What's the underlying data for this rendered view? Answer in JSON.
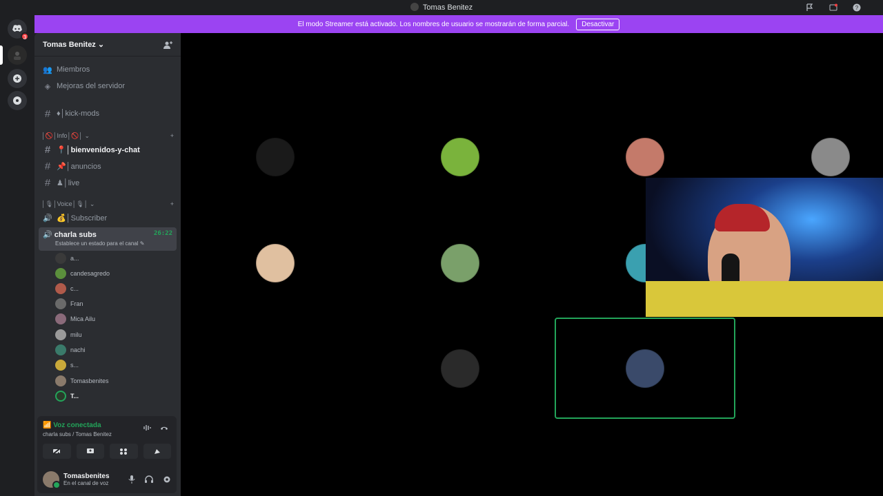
{
  "window": {
    "title": "Tomas Benitez"
  },
  "streamer_banner": {
    "text": "El modo Streamer está activado. Los nombres de usuario se mostrarán de forma parcial.",
    "button": "Desactivar",
    "color": "#9b44f2"
  },
  "guilds": {
    "badge_count": "3"
  },
  "server": {
    "name": "Tomas Benitez"
  },
  "sidebar": {
    "top_items": [
      {
        "label": "Miembros"
      },
      {
        "label": "Mejoras del servidor"
      }
    ],
    "kick_mods": "♦│kick-mods",
    "cat_info": "│🚫│Info│🚫│",
    "text_channels": [
      {
        "label": "📍│bienvenidos-y-chat"
      },
      {
        "label": "📌│anuncios"
      },
      {
        "label": "♟│live"
      }
    ],
    "cat_voice": "│🎙│Voice│🎙│",
    "subscriber": "💰│Subscriber",
    "voice_channel": {
      "name": "charla subs",
      "timer": "26:22",
      "status": "Establece un estado para el canal"
    },
    "voice_users": [
      {
        "name": "a...",
        "color": "#3a3a3a"
      },
      {
        "name": "candesagredo",
        "color": "#5b8f3c"
      },
      {
        "name": "c...",
        "color": "#b05a4a"
      },
      {
        "name": "Fran",
        "color": "#6a6a6a"
      },
      {
        "name": "Mica Ailu",
        "color": "#8a6a7a"
      },
      {
        "name": "milu",
        "color": "#9a9a9a"
      },
      {
        "name": "nachi",
        "color": "#3a7a6a"
      },
      {
        "name": "s...",
        "color": "#c9a93a"
      },
      {
        "name": "Tomasbenites",
        "color": "#8a7a6b"
      },
      {
        "name": "T...",
        "color": "#2a3a2a"
      }
    ]
  },
  "connection": {
    "status": "Voz conectada",
    "path": "charla subs / Tomas Benitez"
  },
  "user": {
    "name": "Tomasbenites",
    "status": "En el canal de voz"
  },
  "tiles": [
    {
      "bg": "#d49a6e",
      "av": "#1a1a1a"
    },
    {
      "bg": "#6e5439",
      "av": "#7ab33c"
    },
    {
      "bg": "#c98b72",
      "av": "#c47a6a"
    },
    {
      "bg": "#3a3739",
      "av": "#8a8a8a"
    },
    {
      "bg": "#8a7470",
      "av": "#e0c0a0"
    },
    {
      "bg": "#c9b9a0",
      "av": "#7aa06a"
    },
    {
      "bg": "#2d5a3a",
      "av": "#3aa0b0"
    },
    {
      "bg": "#c9b9a0",
      "av": "#2a2a2a"
    },
    {
      "bg": "#d0b39e",
      "av": "#3a4a6a"
    }
  ]
}
